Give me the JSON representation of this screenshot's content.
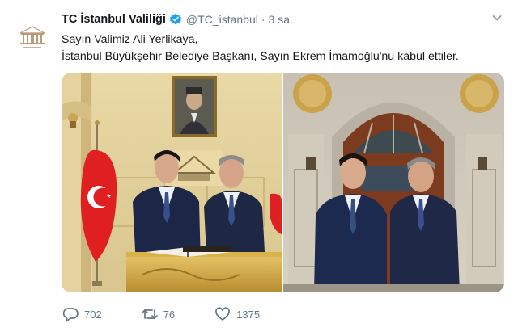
{
  "tweet": {
    "display_name": "TC İstanbul Valiliği",
    "handle": "@TC_istanbul",
    "separator": "·",
    "time": "3 sa.",
    "text_lines": [
      "Sayın Valimiz Ali Yerlikaya,",
      "İstanbul Büyükşehir Belediye Başkanı, Sayın Ekrem İmamoğlu'nu kabul ettiler."
    ],
    "photos": [
      {
        "icon": "photo-meeting-office"
      },
      {
        "icon": "photo-meeting-building-entrance"
      }
    ],
    "actions": {
      "reply_count": "702",
      "retweet_count": "76",
      "like_count": "1375"
    }
  },
  "colors": {
    "text": "#14171a",
    "secondary": "#657786",
    "verified": "#1da1f2"
  }
}
